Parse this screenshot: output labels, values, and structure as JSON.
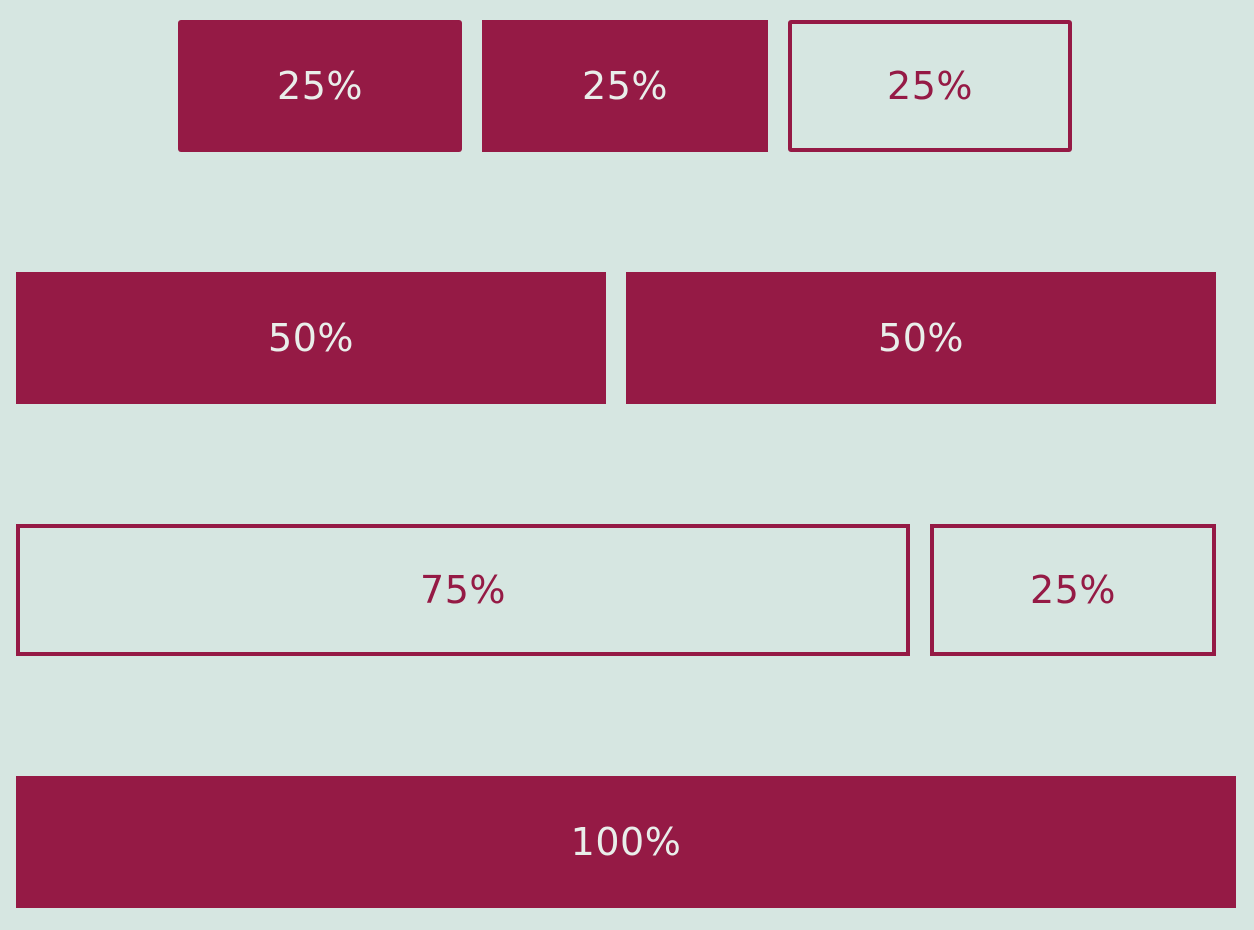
{
  "colors": {
    "background": "#d6e6e1",
    "accent": "#951a45",
    "filled_text": "#e9eeea"
  },
  "rows": [
    {
      "buttons": [
        {
          "label": "25%",
          "style": "filled"
        },
        {
          "label": "25%",
          "style": "filled"
        },
        {
          "label": "25%",
          "style": "outline"
        }
      ]
    },
    {
      "buttons": [
        {
          "label": "50%",
          "style": "filled"
        },
        {
          "label": "50%",
          "style": "filled"
        }
      ]
    },
    {
      "buttons": [
        {
          "label": "75%",
          "style": "outline"
        },
        {
          "label": "25%",
          "style": "outline"
        }
      ]
    },
    {
      "buttons": [
        {
          "label": "100%",
          "style": "filled"
        }
      ]
    }
  ]
}
